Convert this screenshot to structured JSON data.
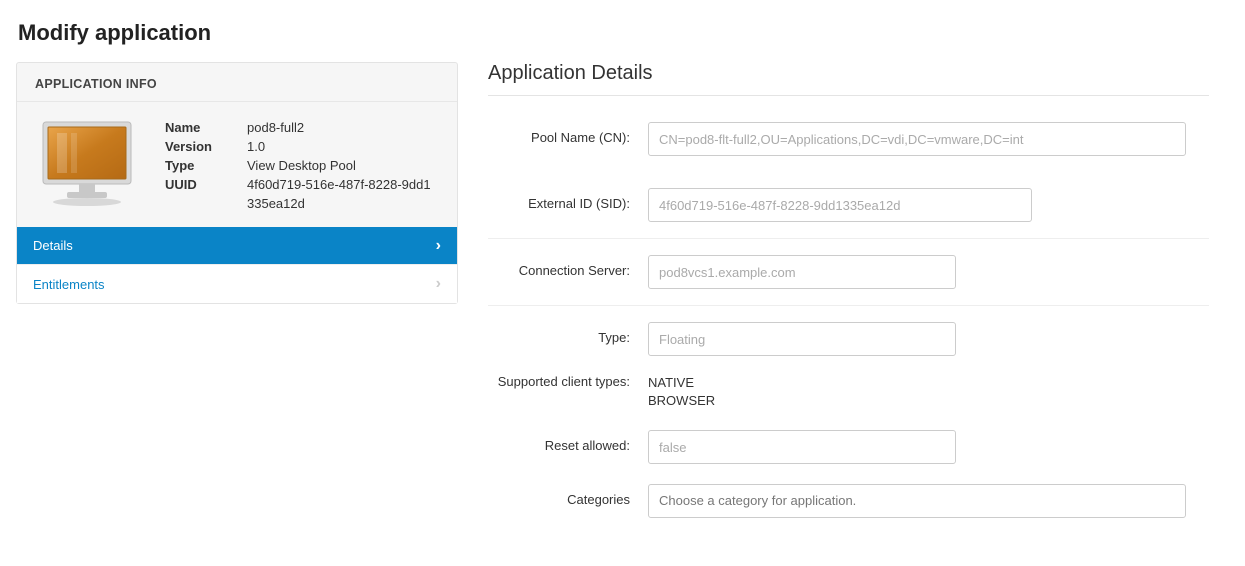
{
  "page_title": "Modify application",
  "info_panel": {
    "header": "APPLICATION INFO",
    "fields": {
      "name_label": "Name",
      "name_value": "pod8-full2",
      "version_label": "Version",
      "version_value": "1.0",
      "type_label": "Type",
      "type_value": "View Desktop Pool",
      "uuid_label": "UUID",
      "uuid_value": "4f60d719-516e-487f-8228-9dd1335ea12d"
    },
    "nav": {
      "details": "Details",
      "entitlements": "Entitlements"
    }
  },
  "details": {
    "section_title": "Application Details",
    "pool_name_label": "Pool Name (CN):",
    "pool_name_value": "CN=pod8-flt-full2,OU=Applications,DC=vdi,DC=vmware,DC=int",
    "external_id_label": "External ID (SID):",
    "external_id_value": "4f60d719-516e-487f-8228-9dd1335ea12d",
    "connection_server_label": "Connection Server:",
    "connection_server_value": "pod8vcs1.example.com",
    "type_label": "Type:",
    "type_value": "Floating",
    "supported_client_label": "Supported client types:",
    "supported_client_value": "NATIVE\nBROWSER",
    "reset_allowed_label": "Reset allowed:",
    "reset_allowed_value": "false",
    "categories_label": "Categories",
    "categories_placeholder": "Choose a category for application."
  }
}
